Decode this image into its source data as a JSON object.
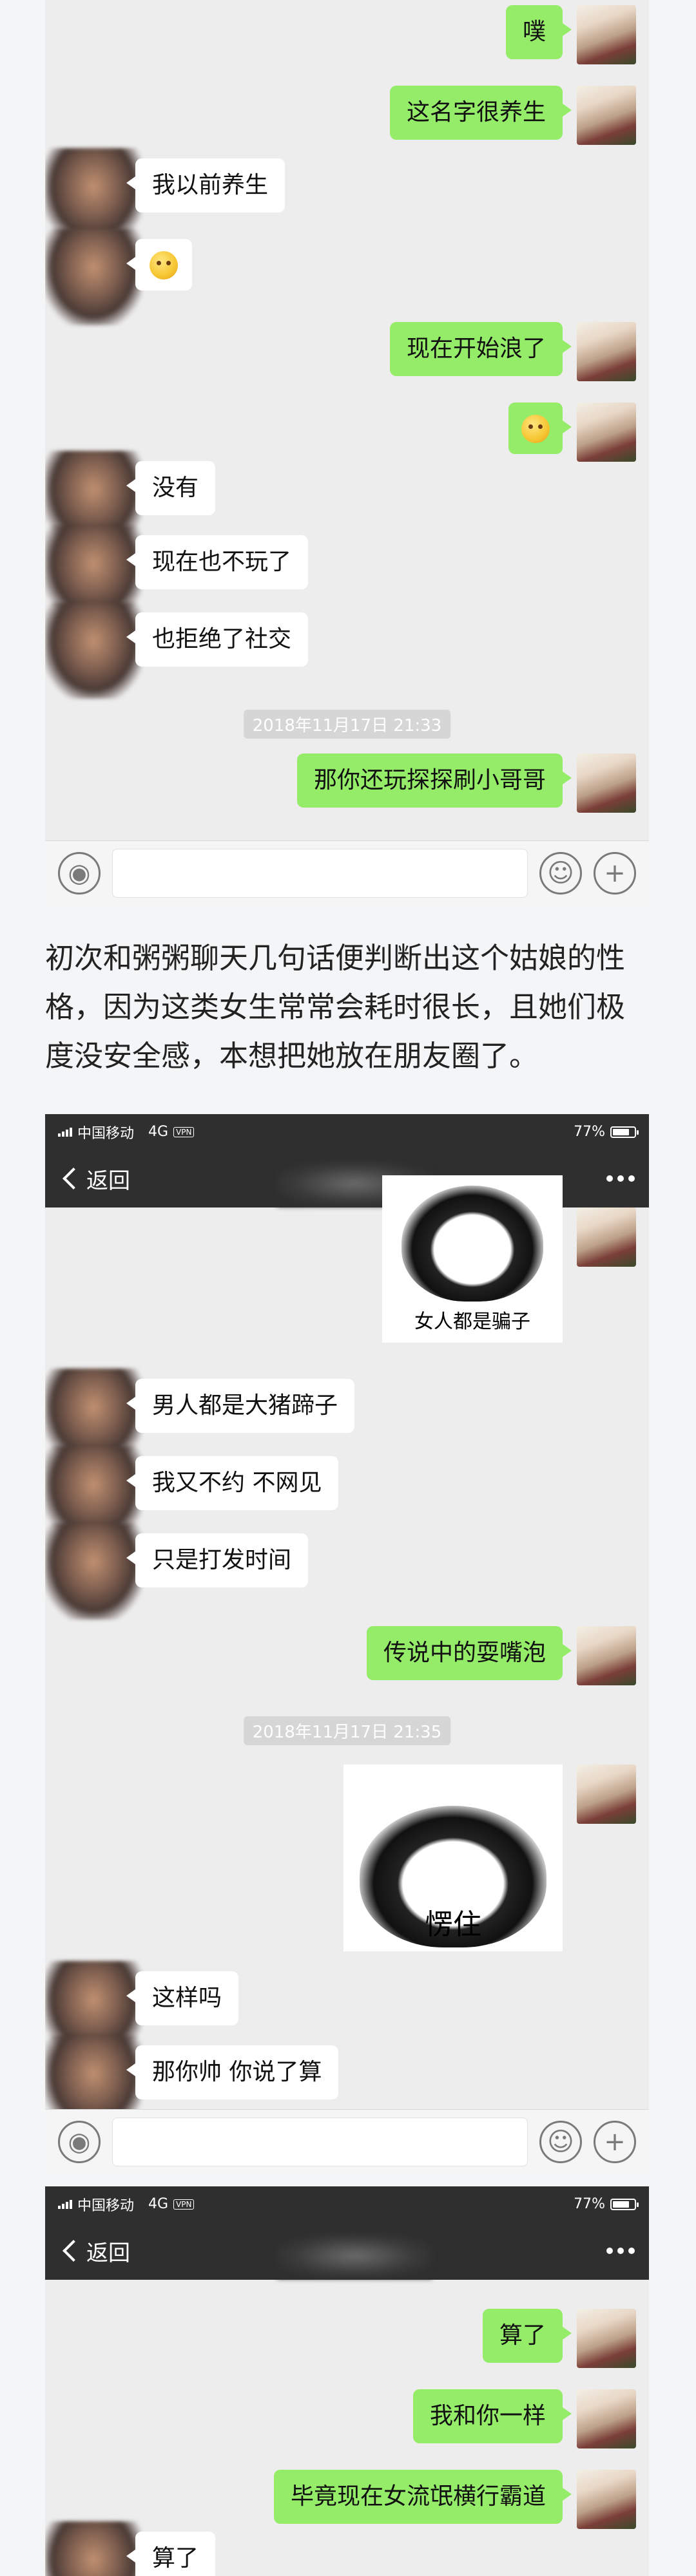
{
  "screen1": {
    "messages": [
      "噗",
      "这名字很养生",
      "我以前养生",
      "现在开始浪了",
      "没有",
      "现在也不玩了",
      "也拒绝了社交",
      "那你还玩探探刷小哥哥"
    ],
    "timestamp": "2018年11月17日 21:33"
  },
  "article": {
    "text": "初次和粥粥聊天几句话便判断出这个姑娘的性格，因为这类女生常常会耗时很长，且她们极度没安全感，本想把她放在朋友圈了。"
  },
  "screen2": {
    "status": {
      "carrier": "中国移动",
      "network": "4G",
      "vpn": "VPN",
      "battery_text": "77%",
      "battery_level": 0.77
    },
    "nav": {
      "back_label": "返回"
    },
    "sticker1_caption": "女人都是骗子",
    "messages": [
      "男人都是大猪蹄子",
      "我又不约 不网见",
      "只是打发时间",
      "传说中的耍嘴泡",
      "这样吗",
      "那你帅 你说了算"
    ],
    "timestamp": "2018年11月17日 21:35",
    "sticker2_caption": "愣住"
  },
  "screen3": {
    "status": {
      "carrier": "中国移动",
      "network": "4G",
      "vpn": "VPN",
      "battery_text": "77%",
      "battery_level": 0.77
    },
    "nav": {
      "back_label": "返回"
    },
    "messages": [
      "算了",
      "我和你一样",
      "毕竟现在女流氓横行霸道",
      "算了"
    ]
  }
}
